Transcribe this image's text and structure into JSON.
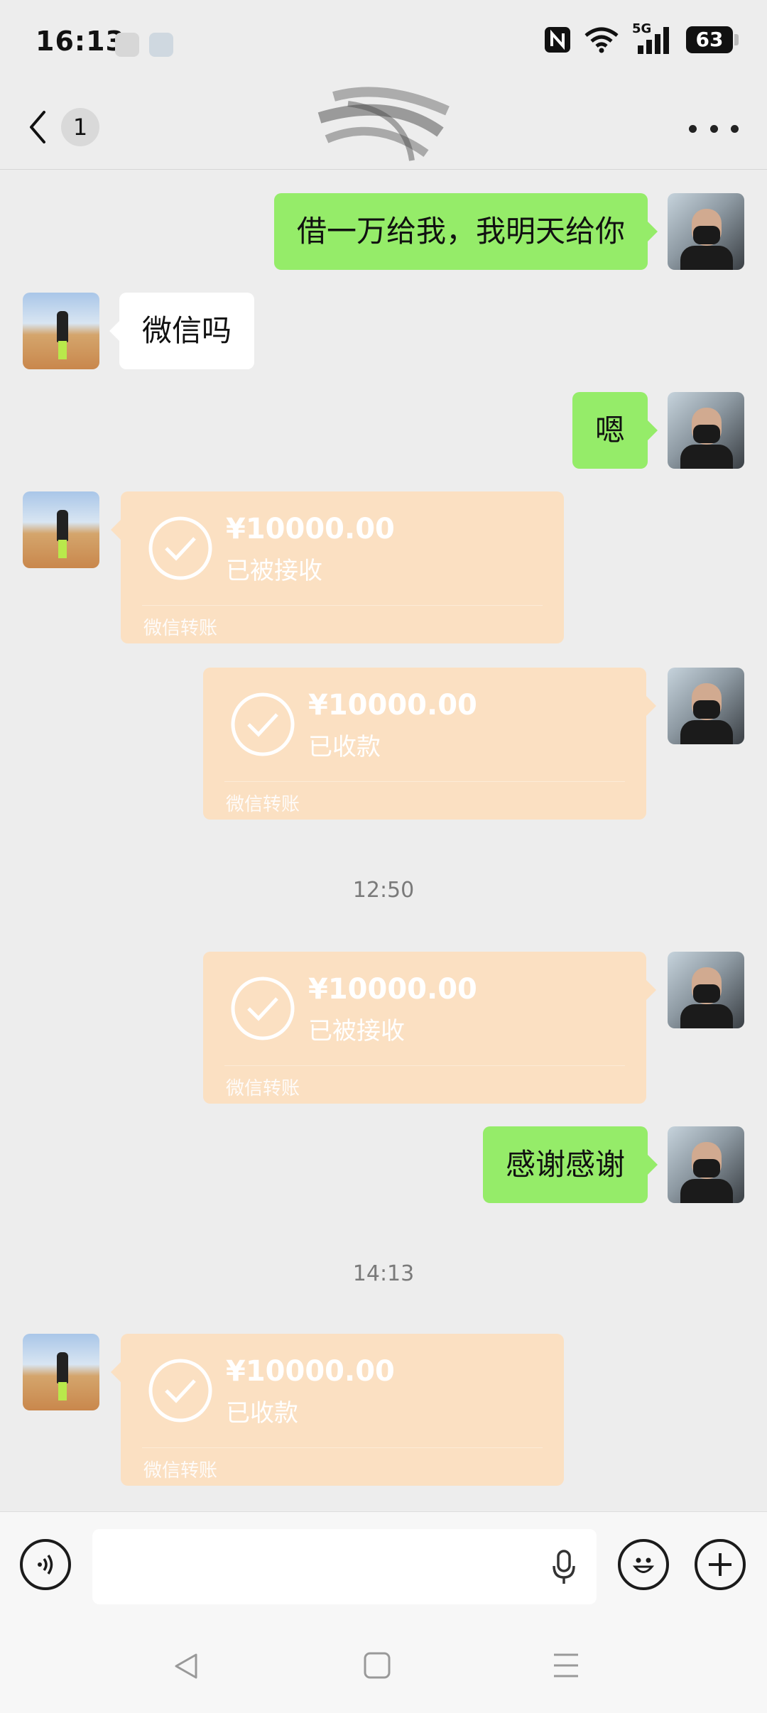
{
  "status_bar": {
    "time": "16:13",
    "network": "5G",
    "battery": "63"
  },
  "header": {
    "unread_count": "1"
  },
  "messages": {
    "m1": {
      "text": "借一万给我，我明天给你"
    },
    "m2": {
      "text": "微信吗"
    },
    "m3": {
      "text": "嗯"
    },
    "t1": {
      "amount": "¥10000.00",
      "status": "已被接收",
      "footer": "微信转账"
    },
    "t2": {
      "amount": "¥10000.00",
      "status": "已收款",
      "footer": "微信转账"
    },
    "ts1": "12:50",
    "t3": {
      "amount": "¥10000.00",
      "status": "已被接收",
      "footer": "微信转账"
    },
    "m4": {
      "text": "感谢感谢"
    },
    "ts2": "14:13",
    "t4": {
      "amount": "¥10000.00",
      "status": "已收款",
      "footer": "微信转账"
    }
  },
  "colors": {
    "sent_bubble": "#95ec69",
    "received_bubble": "#ffffff",
    "transfer_card": "#fbe0c2",
    "background": "#ededed"
  },
  "icons": [
    "back-arrow-icon",
    "more-icon",
    "voice-icon",
    "mic-icon",
    "emoji-icon",
    "plus-icon",
    "nav-back-icon",
    "nav-home-icon",
    "nav-menu-icon",
    "check-icon"
  ]
}
